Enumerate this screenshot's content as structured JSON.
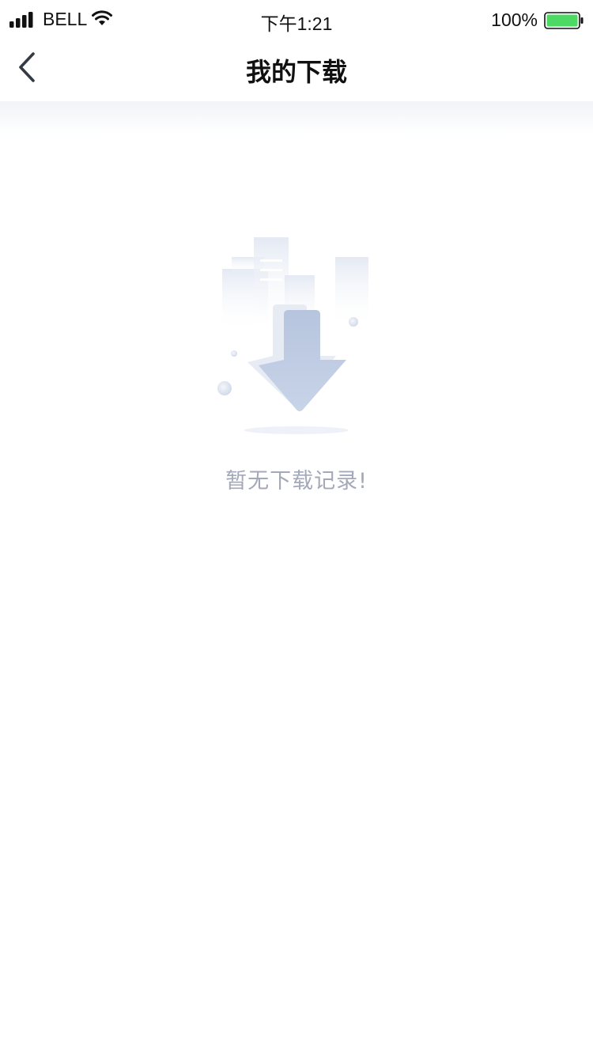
{
  "status_bar": {
    "carrier": "BELL",
    "time": "下午1:21",
    "battery_percent": "100%",
    "battery_color": "#4cd964"
  },
  "nav": {
    "title": "我的下载",
    "back_icon": "chevron-left-icon"
  },
  "empty_state": {
    "message": "暂无下载记录!",
    "icon": "download-arrow-illustration",
    "accent_color": "#c2cfe5"
  }
}
